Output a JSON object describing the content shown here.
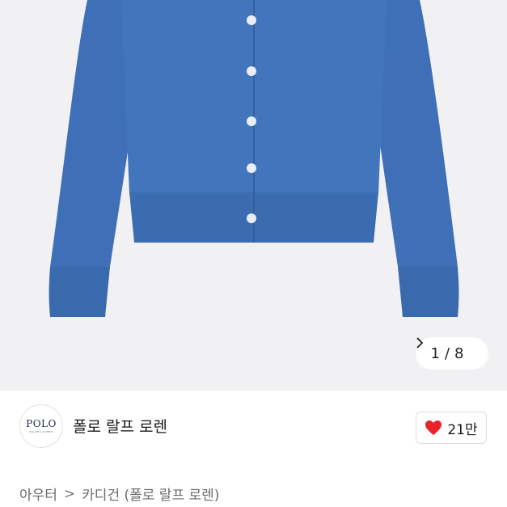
{
  "gallery": {
    "page_current": "1",
    "page_separator": "/",
    "page_total": "8",
    "next_icon": "chevron-right-icon",
    "product_color": "#3e6fb6"
  },
  "brand": {
    "logo_text": "POLO",
    "logo_subtext": "RALPH LAUREN",
    "name": "폴로 랄프 로렌"
  },
  "likes": {
    "icon": "heart-icon",
    "color": "#e8232b",
    "count": "21만"
  },
  "breadcrumb": {
    "items": [
      "아우터",
      "카디건 (폴로 랄프 로렌)"
    ],
    "separator": ">"
  }
}
